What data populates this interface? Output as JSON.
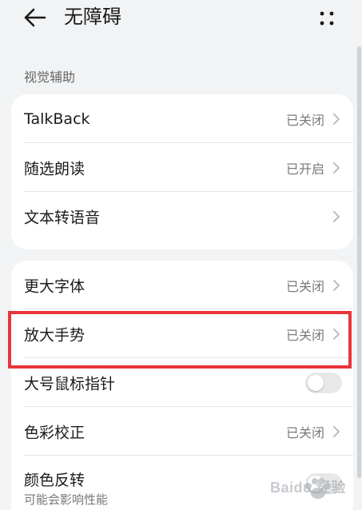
{
  "header": {
    "title": "无障碍",
    "back_icon": "back-arrow-icon",
    "more_icon": "more-dots-icon"
  },
  "section": {
    "vision_label": "视觉辅助"
  },
  "card1": {
    "items": [
      {
        "label": "TalkBack",
        "status": "已关闭"
      },
      {
        "label": "随选朗读",
        "status": "已开启"
      },
      {
        "label": "文本转语音",
        "status": ""
      }
    ]
  },
  "card2": {
    "items": [
      {
        "label": "更大字体",
        "status": "已关闭"
      },
      {
        "label": "放大手势",
        "status": "已关闭"
      },
      {
        "label": "大号鼠标指针",
        "toggle": false
      },
      {
        "label": "色彩校正",
        "status": "已关闭"
      },
      {
        "label": "颜色反转",
        "sublabel": "可能会影响性能",
        "toggle": false
      }
    ]
  },
  "watermark": {
    "text": "Baidu 经验"
  },
  "colors": {
    "background": "#f1f3f5",
    "card": "#ffffff",
    "highlight": "#e8353b",
    "secondary_text": "#7a7a7a"
  }
}
